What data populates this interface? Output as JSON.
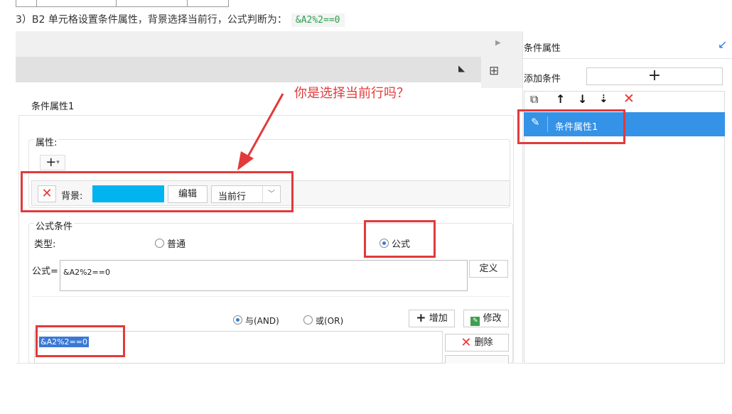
{
  "caption": {
    "text": "3）B2 单元格设置条件属性，背景选择当前行，公式判断为：",
    "code": "&A2%2==0"
  },
  "left": {
    "condition_name": "条件属性1",
    "attributes_label": "属性:",
    "add_attr_symbol": "+",
    "background": {
      "label": "背景:",
      "color": "#00b4ef",
      "edit_label": "编辑",
      "scope_value": "当前行"
    },
    "formula_section": {
      "title": "公式条件",
      "type_label": "类型:",
      "option_normal": "普通",
      "option_formula": "公式",
      "selected": "公式",
      "formula_label": "公式=",
      "formula_value": "&A2%2==0",
      "define_label": "定义",
      "and_label": "与(AND)",
      "or_label": "或(OR)",
      "logic_selected": "与(AND)",
      "add_label": "增加",
      "modify_label": "修改",
      "delete_label": "删除",
      "list_items": [
        "&A2%2==0"
      ]
    }
  },
  "right": {
    "title": "条件属性",
    "add_condition_label": "添加条件",
    "add_symbol": "+",
    "items": [
      "条件属性1"
    ],
    "selected_item": "条件属性1"
  },
  "annotation": {
    "text": "你是选择当前行吗？",
    "color": "#e23a3a"
  }
}
